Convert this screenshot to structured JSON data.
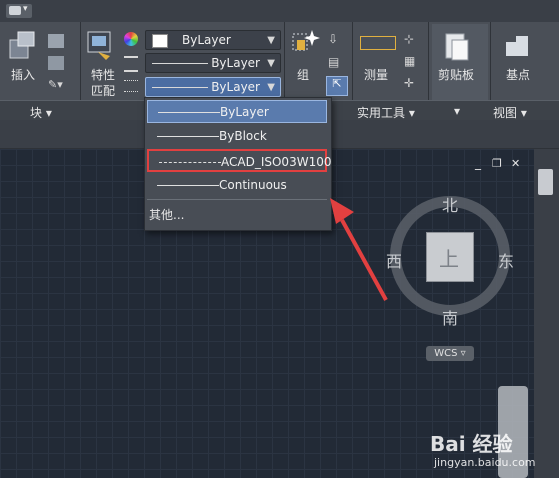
{
  "qat": {
    "menu_glyph": "▾"
  },
  "ribbon": {
    "insert_label": "插入",
    "block_panel": "块 ▾",
    "match_props_line1": "特性",
    "match_props_line2": "匹配",
    "color_combo": "ByLayer",
    "linetype_combo": "ByLayer",
    "lineweight_combo": "ByLayer",
    "group_label": "组",
    "measure_label": "测量",
    "utilities_panel": "实用工具 ▾",
    "clipboard_label": "剪贴板",
    "clipboard_panel": "▾",
    "base_label": "基点",
    "view_panel": "视图 ▾"
  },
  "dropdown": {
    "items": [
      {
        "label": "ByLayer",
        "highlighted": true
      },
      {
        "label": "ByBlock",
        "highlighted": false
      },
      {
        "label": "ACAD_ISO03W100",
        "highlighted": false,
        "outlined": true
      },
      {
        "label": "Continuous",
        "highlighted": false
      }
    ],
    "other": "其他..."
  },
  "viewcube": {
    "north": "北",
    "south": "南",
    "east": "东",
    "west": "西",
    "face": "上",
    "wcs": "WCS ▿"
  },
  "viewport_controls": {
    "minimize": "_",
    "restore": "❐",
    "close": "✕"
  },
  "watermark": {
    "brand": "Bai 经验",
    "url": "jingyan.baidu.com"
  },
  "colors": {
    "highlight": "#5a7bad",
    "annotation_red": "#e24040",
    "canvas": "#222a36"
  }
}
